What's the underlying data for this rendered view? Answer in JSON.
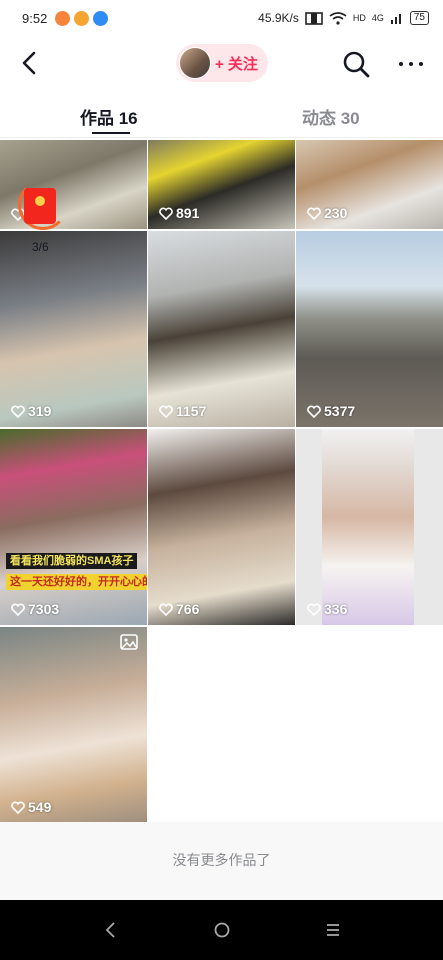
{
  "status_bar": {
    "time": "9:52",
    "network_speed": "45.9K/s",
    "network_type": "4G",
    "hd_label": "HD",
    "battery": "75",
    "app_icon_colors": [
      "#f6843c",
      "#f7a532",
      "#2f8cf2"
    ]
  },
  "header": {
    "back_icon": "chevron-left-icon",
    "follow_label": "+ 关注",
    "search_icon": "search-icon",
    "more_icon": "more-dots-icon"
  },
  "tabs": [
    {
      "label": "作品 16",
      "active": true
    },
    {
      "label": "动态 30",
      "active": false
    }
  ],
  "accent_color": "#fe2c55",
  "videos": [
    {
      "likes": "891"
    },
    {
      "likes": "230"
    },
    {
      "likes": "319"
    },
    {
      "likes": "1157"
    },
    {
      "likes": "5377"
    },
    {
      "likes": "7303",
      "caption_lines": [
        "看看我们脆弱的SMA孩子",
        "这一天还好好的，开开心心的"
      ]
    },
    {
      "likes": "766"
    },
    {
      "likes": "336"
    },
    {
      "likes": "549",
      "badge_icon": "image-icon"
    }
  ],
  "red_packet": {
    "progress": "3/6",
    "icon": "red-envelope-icon"
  },
  "footer": {
    "no_more_text": "没有更多作品了"
  },
  "nav_bar": {
    "back_icon": "nav-back-icon",
    "home_icon": "nav-home-icon",
    "menu_icon": "nav-menu-icon"
  }
}
